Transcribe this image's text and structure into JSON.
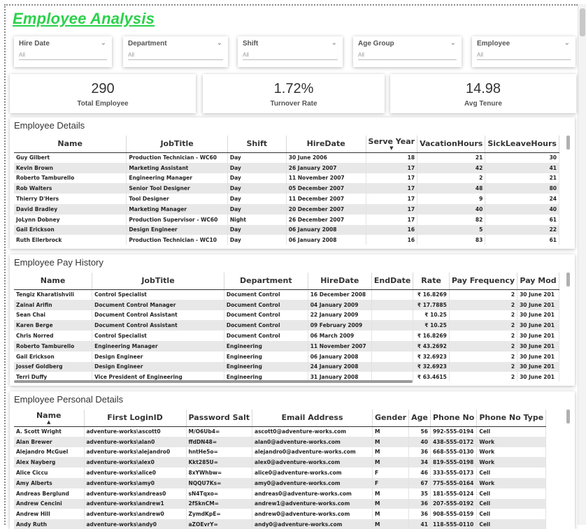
{
  "title": "Employee Analysis",
  "slicers": [
    {
      "label": "Hire Date",
      "value": "All"
    },
    {
      "label": "Department",
      "value": "All"
    },
    {
      "label": "Shift",
      "value": "All"
    },
    {
      "label": "Age Group",
      "value": "All"
    },
    {
      "label": "Employee",
      "value": "All"
    }
  ],
  "cards": [
    {
      "value": "290",
      "label": "Total Employee"
    },
    {
      "value": "1.72%",
      "label": "Turnover Rate"
    },
    {
      "value": "14.98",
      "label": "Avg Tenure"
    }
  ],
  "employee_details": {
    "title": "Employee Details",
    "columns": [
      "Name",
      "JobTitle",
      "Shift",
      "HireDate",
      "Serve Year",
      "VacationHours",
      "SickLeaveHours"
    ],
    "rows": [
      [
        "Guy Gilbert",
        "Production Technician - WC60",
        "Day",
        "30 June 2006",
        "18",
        "21",
        "30"
      ],
      [
        "Kevin Brown",
        "Marketing Assistant",
        "Day",
        "26 January 2007",
        "17",
        "42",
        "41"
      ],
      [
        "Roberto Tamburello",
        "Engineering Manager",
        "Day",
        "11 November 2007",
        "17",
        "2",
        "21"
      ],
      [
        "Rob Walters",
        "Senior Tool Designer",
        "Day",
        "05 December 2007",
        "17",
        "48",
        "80"
      ],
      [
        "Thierry D'Hers",
        "Tool Designer",
        "Day",
        "11 December 2007",
        "17",
        "9",
        "24"
      ],
      [
        "David Bradley",
        "Marketing Manager",
        "Day",
        "20 December 2007",
        "17",
        "40",
        "40"
      ],
      [
        "JoLynn Dobney",
        "Production Supervisor - WC60",
        "Night",
        "26 December 2007",
        "17",
        "82",
        "61"
      ],
      [
        "Gail Erickson",
        "Design Engineer",
        "Day",
        "06 January 2008",
        "16",
        "5",
        "22"
      ],
      [
        "Ruth Ellerbrock",
        "Production Technician - WC10",
        "Day",
        "06 January 2008",
        "16",
        "83",
        "61"
      ]
    ]
  },
  "pay_history": {
    "title": "Employee Pay History",
    "columns": [
      "Name",
      "JobTitle",
      "Department",
      "HireDate",
      "EndDate",
      "Rate",
      "Pay Frequency",
      "Pay Mod"
    ],
    "rows": [
      [
        "Tengiz Kharatishvili",
        "Control Specialist",
        "Document Control",
        "16 December 2008",
        "",
        "₹ 16.8269",
        "2",
        "30 June 201"
      ],
      [
        "Zainal Arifin",
        "Document Control Manager",
        "Document Control",
        "04 January 2009",
        "",
        "₹ 17.7885",
        "2",
        "30 June 201"
      ],
      [
        "Sean Chai",
        "Document Control Assistant",
        "Document Control",
        "22 January 2009",
        "",
        "₹ 10.25",
        "2",
        "30 June 201"
      ],
      [
        "Karen Berge",
        "Document Control Assistant",
        "Document Control",
        "09 February 2009",
        "",
        "₹ 10.25",
        "2",
        "30 June 201"
      ],
      [
        "Chris Norred",
        "Control Specialist",
        "Document Control",
        "06 March 2009",
        "",
        "₹ 16.8269",
        "2",
        "30 June 201"
      ],
      [
        "Roberto Tamburello",
        "Engineering Manager",
        "Engineering",
        "11 November 2007",
        "",
        "₹ 43.2692",
        "2",
        "30 June 201"
      ],
      [
        "Gail Erickson",
        "Design Engineer",
        "Engineering",
        "06 January 2008",
        "",
        "₹ 32.6923",
        "2",
        "30 June 201"
      ],
      [
        "Jossef Goldberg",
        "Design Engineer",
        "Engineering",
        "24 January 2008",
        "",
        "₹ 32.6923",
        "2",
        "30 June 201"
      ],
      [
        "Terri Duffy",
        "Vice President of Engineering",
        "Engineering",
        "31 January 2008",
        "",
        "₹ 63.4615",
        "2",
        "30 June 201"
      ]
    ]
  },
  "personal_details": {
    "title": "Employee Personal Details",
    "columns": [
      "Name",
      "First LoginID",
      "Password Salt",
      "Email Address",
      "Gender",
      "Age",
      "Phone No",
      "Phone No Type"
    ],
    "rows": [
      [
        "A. Scott Wright",
        "adventure-works\\ascott0",
        "M/O6Ub4=",
        "ascott0@adventure-works.com",
        "M",
        "56",
        "992-555-0194",
        "Cell"
      ],
      [
        "Alan Brewer",
        "adventure-works\\alan0",
        "ffdDN48=",
        "alan0@adventure-works.com",
        "M",
        "40",
        "438-555-0172",
        "Work"
      ],
      [
        "Alejandro McGuel",
        "adventure-works\\alejandro0",
        "hntHe5o=",
        "alejandro0@adventure-works.com",
        "M",
        "36",
        "668-555-0130",
        "Work"
      ],
      [
        "Alex Nayberg",
        "adventure-works\\alex0",
        "Kkt285U=",
        "alex0@adventure-works.com",
        "M",
        "34",
        "819-555-0198",
        "Work"
      ],
      [
        "Alice Ciccu",
        "adventure-works\\alice0",
        "8xYWhbw=",
        "alice0@adventure-works.com",
        "F",
        "46",
        "333-555-0173",
        "Cell"
      ],
      [
        "Amy Alberts",
        "adventure-works\\amy0",
        "NQQU7Ks=",
        "amy0@adventure-works.com",
        "F",
        "67",
        "775-555-0164",
        "Work"
      ],
      [
        "Andreas Berglund",
        "adventure-works\\andreas0",
        "sN4Tqxo=",
        "andreas0@adventure-works.com",
        "M",
        "35",
        "181-555-0124",
        "Cell"
      ],
      [
        "Andrew Cencini",
        "adventure-works\\andrew1",
        "2fSknCM=",
        "andrew1@adventure-works.com",
        "M",
        "36",
        "207-555-0192",
        "Cell"
      ],
      [
        "Andrew Hill",
        "adventure-works\\andrew0",
        "ZymdKpE=",
        "andrew0@adventure-works.com",
        "M",
        "36",
        "908-555-0159",
        "Cell"
      ],
      [
        "Andy Ruth",
        "adventure-works\\andy0",
        "aZOEvrY=",
        "andy0@adventure-works.com",
        "M",
        "41",
        "118-555-0110",
        "Cell"
      ]
    ]
  }
}
